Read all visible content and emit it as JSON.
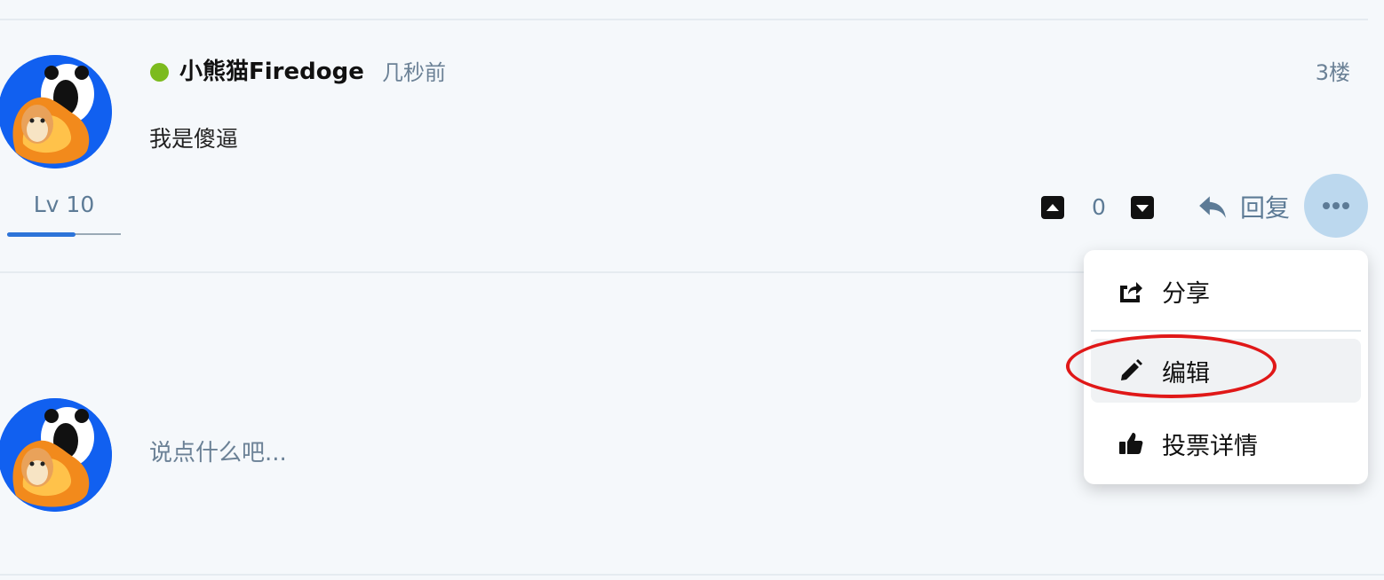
{
  "post": {
    "username": "小熊猫Firedoge",
    "timestamp": "几秒前",
    "floor": "3楼",
    "body": "我是傻逼",
    "level": "Lv 10",
    "level_progress": 0.6,
    "vote_count": "0",
    "reply_label": "回复",
    "online_status_color": "#7cbb1e"
  },
  "menu": {
    "items": [
      {
        "label": "分享",
        "icon": "share-square-icon"
      },
      {
        "label": "编辑",
        "icon": "pencil-icon"
      },
      {
        "label": "投票详情",
        "icon": "thumbs-up-icon"
      }
    ]
  },
  "composer": {
    "placeholder": "说点什么吧..."
  },
  "colors": {
    "accent": "#2d74d9",
    "muted_text": "#6b8196",
    "more_button_bg": "#bcd8ee",
    "annotation": "#e01818"
  }
}
